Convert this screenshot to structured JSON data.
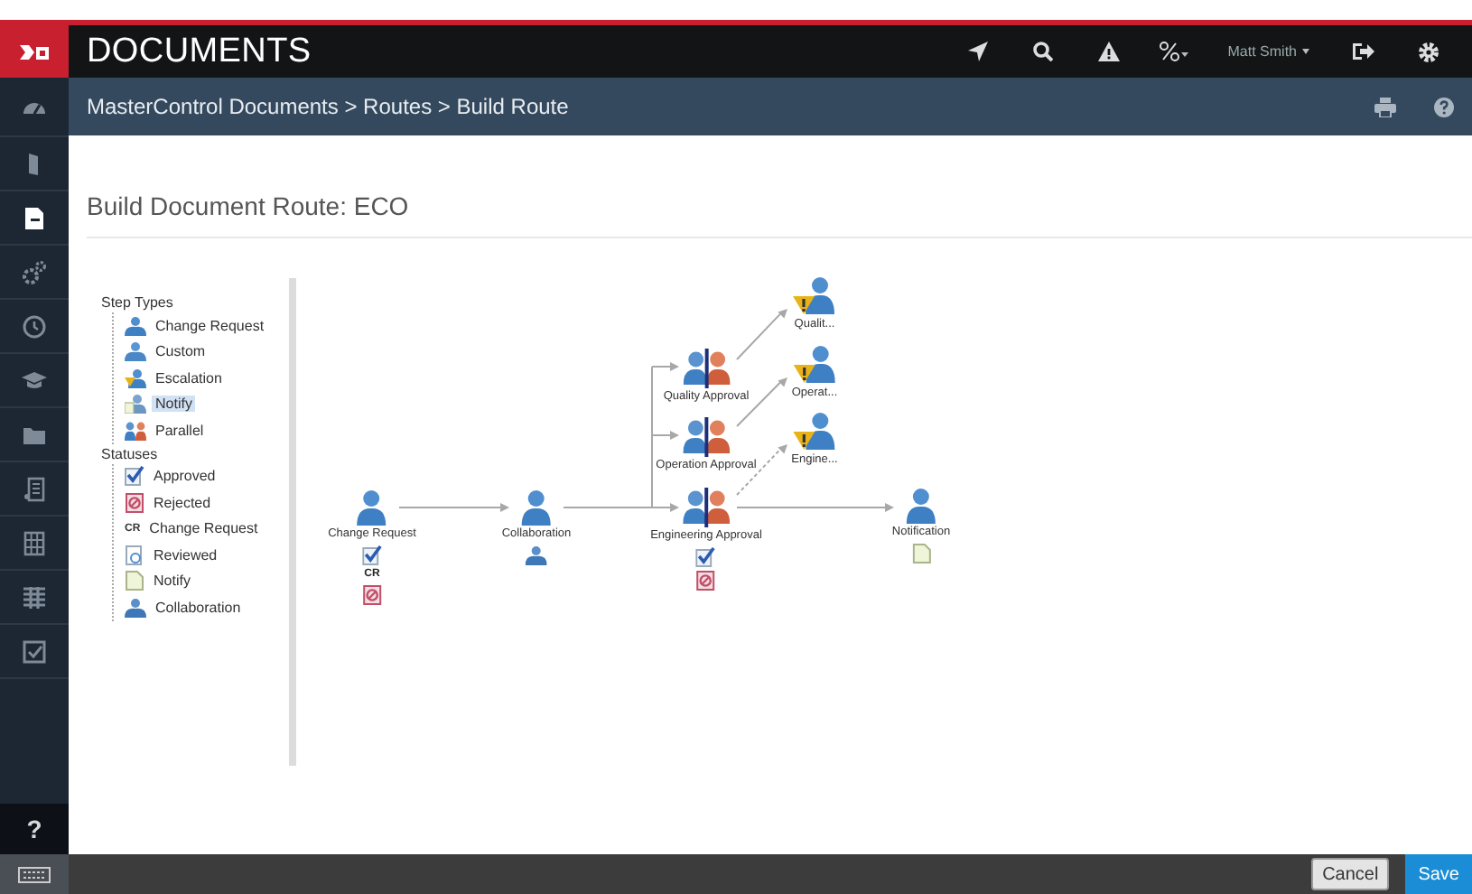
{
  "app": {
    "title": "DOCUMENTS",
    "user": "Matt Smith"
  },
  "breadcrumb": "MasterControl Documents > Routes > Build Route",
  "sidebar": {
    "items": [
      {
        "kind": "dashboard",
        "selected": false
      },
      {
        "kind": "door",
        "selected": false
      },
      {
        "kind": "document",
        "selected": true
      },
      {
        "kind": "gears",
        "selected": false
      },
      {
        "kind": "history",
        "selected": false
      },
      {
        "kind": "cap",
        "selected": false
      },
      {
        "kind": "folder",
        "selected": false
      },
      {
        "kind": "form",
        "selected": false
      },
      {
        "kind": "grid",
        "selected": false
      },
      {
        "kind": "table",
        "selected": false
      },
      {
        "kind": "checklist",
        "selected": false
      }
    ],
    "help": "?"
  },
  "page_title": "Build Document Route: ECO",
  "palette": {
    "groups": [
      {
        "label": "Step Types",
        "children": [
          {
            "label": "Change Request",
            "kind": "change-request",
            "selected": false
          },
          {
            "label": "Custom",
            "kind": "custom",
            "selected": false
          },
          {
            "label": "Escalation",
            "kind": "escalation",
            "selected": false
          },
          {
            "label": "Notify",
            "kind": "notify-step",
            "selected": true
          },
          {
            "label": "Parallel",
            "kind": "parallel",
            "selected": false
          }
        ]
      },
      {
        "label": "Statuses",
        "children": [
          {
            "label": "Approved",
            "kind": "approved",
            "selected": false
          },
          {
            "label": "Rejected",
            "kind": "rejected",
            "selected": false
          },
          {
            "label": "Change Request",
            "kind": "cr",
            "icon_text": "CR",
            "selected": false
          },
          {
            "label": "Reviewed",
            "kind": "reviewed",
            "selected": false
          },
          {
            "label": "Notify",
            "kind": "notify",
            "selected": false
          },
          {
            "label": "Collaboration",
            "kind": "collaboration",
            "selected": false
          }
        ]
      }
    ]
  },
  "route": {
    "nodes": [
      {
        "label": "Change Request",
        "kind": "person",
        "statuses": [
          {
            "kind": "approved"
          },
          {
            "kind": "cr",
            "text": "CR"
          },
          {
            "kind": "rejected"
          }
        ]
      },
      {
        "label": "Collaboration",
        "kind": "person",
        "statuses": [
          {
            "kind": "collaboration"
          }
        ]
      },
      {
        "label": "Quality Approval",
        "kind": "parallel"
      },
      {
        "label": "Operation Approval",
        "kind": "parallel"
      },
      {
        "label": "Engineering Approval",
        "kind": "parallel",
        "statuses": [
          {
            "kind": "approved"
          },
          {
            "kind": "rejected"
          }
        ]
      },
      {
        "label": "Qualit...",
        "kind": "escalation"
      },
      {
        "label": "Operat...",
        "kind": "escalation"
      },
      {
        "label": "Engine...",
        "kind": "escalation"
      },
      {
        "label": "Notification",
        "kind": "person",
        "statuses": [
          {
            "kind": "notify"
          }
        ]
      }
    ]
  },
  "footer": {
    "buttons": [
      {
        "label": "Cancel",
        "kind": "secondary"
      },
      {
        "label": "Save",
        "kind": "primary"
      }
    ]
  }
}
